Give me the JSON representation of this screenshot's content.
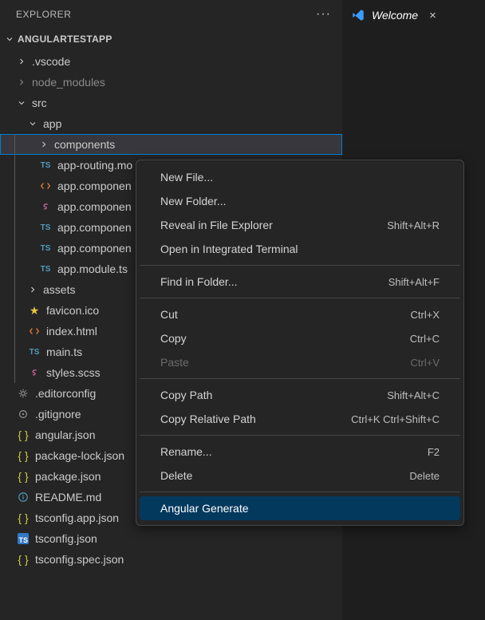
{
  "explorer": {
    "title": "EXPLORER",
    "project": "ANGULARTESTAPP"
  },
  "tree": {
    "vscode": ".vscode",
    "node_modules": "node_modules",
    "src": "src",
    "app": "app",
    "components": "components",
    "app_routing": "app-routing.mo",
    "app_comp_html": "app.componen",
    "app_comp_scss": "app.componen",
    "app_comp_spec": "app.componen",
    "app_comp_ts": "app.componen",
    "app_module": "app.module.ts",
    "assets": "assets",
    "favicon": "favicon.ico",
    "index": "index.html",
    "main": "main.ts",
    "styles": "styles.scss",
    "editorconfig": ".editorconfig",
    "gitignore": ".gitignore",
    "angular_json": "angular.json",
    "package_lock": "package-lock.json",
    "package_json": "package.json",
    "readme": "README.md",
    "tsconfig_app": "tsconfig.app.json",
    "tsconfig": "tsconfig.json",
    "tsconfig_spec": "tsconfig.spec.json"
  },
  "tab": {
    "label": "Welcome"
  },
  "menu": {
    "new_file": "New File...",
    "new_folder": "New Folder...",
    "reveal": "Reveal in File Explorer",
    "reveal_key": "Shift+Alt+R",
    "open_terminal": "Open in Integrated Terminal",
    "find_folder": "Find in Folder...",
    "find_folder_key": "Shift+Alt+F",
    "cut": "Cut",
    "cut_key": "Ctrl+X",
    "copy": "Copy",
    "copy_key": "Ctrl+C",
    "paste": "Paste",
    "paste_key": "Ctrl+V",
    "copy_path": "Copy Path",
    "copy_path_key": "Shift+Alt+C",
    "copy_rel_path": "Copy Relative Path",
    "copy_rel_path_key": "Ctrl+K Ctrl+Shift+C",
    "rename": "Rename...",
    "rename_key": "F2",
    "delete": "Delete",
    "delete_key": "Delete",
    "angular_generate": "Angular Generate"
  }
}
